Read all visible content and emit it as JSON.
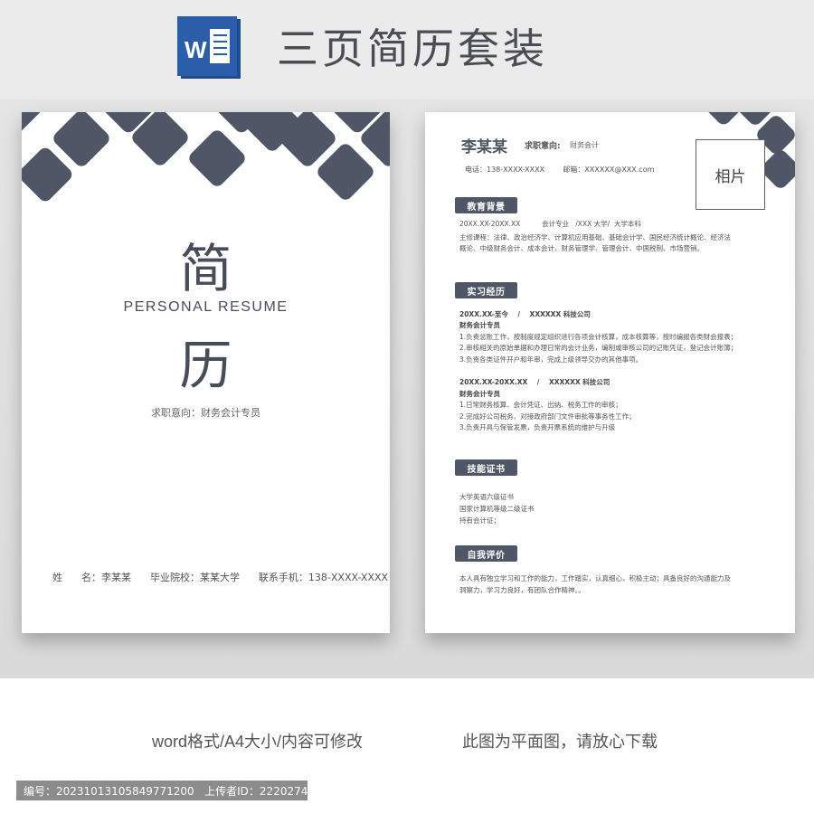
{
  "banner": {
    "title": "三页简历套装",
    "icon": "word-icon",
    "icon_letter": "W"
  },
  "cover": {
    "char1": "简",
    "subtitle": "PERSONAL    RESUME",
    "char2": "历",
    "intent": "求职意向：财务会计专员",
    "info": "姓      名：李某某      毕业院校：某某大学      联系手机：138-XXXX-XXXX"
  },
  "resume": {
    "name": "李某某",
    "intent_label": "求职意向:",
    "intent_value": "财务会计",
    "contact": "电话：138-XXXX-XXXX        邮箱：XXXXXX@XXX.com",
    "photo_label": "相片",
    "sections": {
      "education": {
        "title": "教育背景",
        "lines": [
          "20XX.XX-20XX.XX          会计专业   /XXX 大学/  大学本科",
          "主修课程：法律、政治经济学、计算机应用基础、基础会计学、国民经济统计概论、经济法",
          "概论、中级财务会计、成本会计、财务管理学、管理会计、中国税制、市场营销。"
        ]
      },
      "internship": {
        "title": "实习经历",
        "lines": [
          "20XX.XX-至今    /    XXXXXX 科技公司",
          "财务会计专员",
          "1.负责总账工作，按制度规定组织进行各项会计核算，成本核算等，按时编报各类财会报表；",
          "2.审核相关的原始单据和办理日常的会计业务，编制或审核公司的记账凭证，登记会计账簿；",
          "3.负责各类证件开户和年审，完成上级领导交办的其他事项。",
          "20XX.XX-20XX.XX    /    XXXXXX 科技公司",
          "财务会计专员",
          "1.日常财务核算、会计凭证、出纳、税务工作的审核；",
          "2.完成好公司税务、对接政府部门文件审批等事务性工作；",
          "3.负责开具与保管发票，负责开票系统的维护与升级"
        ]
      },
      "skills": {
        "title": "技能证书",
        "lines": [
          "大学英语六级证书",
          "国家计算机等级二级证书",
          "持有会计证；"
        ]
      },
      "self_eval": {
        "title": "自我评价",
        "lines": [
          "本人具有独立学习和工作的能力，工作踏实，认真细心，积极主动；具备良好的沟通能力及",
          "洞察力，学习力良好，有团队合作精神。。"
        ]
      }
    }
  },
  "bottom": {
    "format_text": "word格式/A4大小/内容可修改",
    "download_text": "此图为平面图，请放心下载"
  },
  "footer": {
    "text": "编号：20231013105849771200   上传者ID：2220274"
  },
  "colors": {
    "accent": "#4f5766",
    "word_blue": "#2b579a"
  }
}
